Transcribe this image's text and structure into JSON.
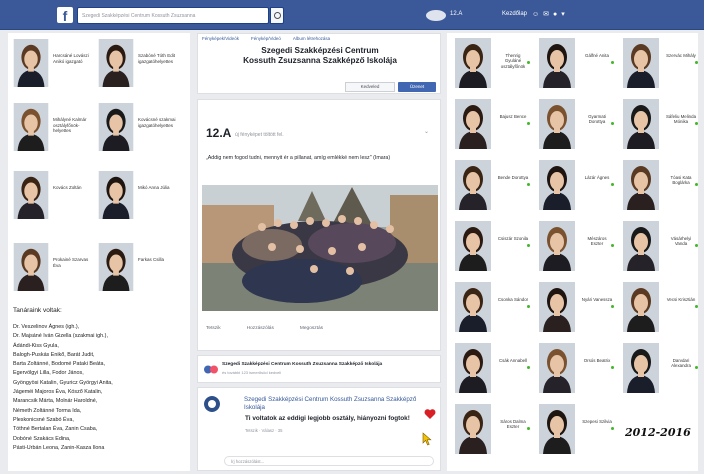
{
  "topbar": {
    "search_placeholder": "Szegedi Szakképzési Centrum Kossuth Zsuzsanna",
    "user": "12.A",
    "home": "Kezdőlap",
    "icons": [
      "people-icon",
      "messages-icon",
      "notifications-icon",
      "settings-icon"
    ]
  },
  "page": {
    "tabs": [
      "Fényképek/Videók",
      "Fénykép/Videó",
      "Album létrehozása"
    ],
    "title_line1": "Szegedi Szakképzési Centrum",
    "title_line2": "Kossuth Zsuzsanna Szakképző Iskolája",
    "liked_label": "Kedveled",
    "message_label": "Üzenet"
  },
  "post": {
    "class_name": "12.A",
    "subtitle": "új fényképet töltött fel.",
    "quote": "„Addig nem fogod tudni, mennyit ér a pillanat, amíg emlékké nem lesz\"",
    "quote_author": "(Imara)",
    "actions": [
      "Tetszik",
      "Hozzászólás",
      "Megosztás"
    ]
  },
  "share": {
    "title": "Szegedi Szakképzési Centrum Kossuth Zsuzsanna Szakképző Iskolája",
    "subtitle": "és további 123 ismerősöd kedveli"
  },
  "comment": {
    "author": "Szegedi Szakképzési Centrum Kossuth Zsuzsanna Szakképző Iskolája",
    "text": "Ti voltatok az eddigi legjobb osztály, hiányozni fogtok!",
    "meta": "Tetszik · Válasz · 35",
    "write_placeholder": "Írj hozzászólást..."
  },
  "staff": [
    {
      "name": "Harcsáné Lovászi Anikó igazgató"
    },
    {
      "name": "Szabóné Tóth Edit igazgatóhelyettes"
    },
    {
      "name": "Mihályné Kalmár osztályfőnök-helyettes"
    },
    {
      "name": "Kovácsné szakmai igazgatóhelyettes"
    },
    {
      "name": "Kovács Zoltán"
    },
    {
      "name": "Mikó Anna Júlia"
    },
    {
      "name": "Prokainé Szarvas Éva"
    },
    {
      "name": "Farkas Csilla"
    }
  ],
  "teachers_title": "Tanáraink voltak:",
  "teachers": [
    "Dr. Veszelinov Ágnes (igh.),",
    "Dr. Majsáné Iván Gizella (szakmai igh.),",
    "Ádándi-Kiss Gyula,",
    "Balogh-Puskás Enikő, Barát Judit,",
    "Barta Zoltánné, Bodomé Pataki Beáta,",
    "Egervölgyi Lilla, Fodor János,",
    "Gyöngyösi Katalin, Gyuricz Györgyi Anita,",
    "Jágeméi Majoros Éva, Kósző Katalin,",
    "Marancsik Márta, Molnár Haroldné,",
    "Németh Zoltánné Torma Ida,",
    "Pleskonicsné Szabó Éva,",
    "Tóthné Bertalan Éva, Zanin Csaba,",
    "Dobóné Szakács Edina,",
    "Pásti-Urbán Leona, Zanin-Kasza Ilona"
  ],
  "students": [
    {
      "name": "Thenrig Gyuláné osztályfőnök"
    },
    {
      "name": "Gálfné Anita"
    },
    {
      "name": "Szervác Mihály"
    },
    {
      "name": "Bajusz Bence"
    },
    {
      "name": "Gyarmati Dorottya"
    },
    {
      "name": "Sáfeliu Melinda Mónika"
    },
    {
      "name": "Bende Dorottya"
    },
    {
      "name": "Lázár Ágnes"
    },
    {
      "name": "Tóasi Kata Boglárka"
    },
    {
      "name": "Csiszár Szonila"
    },
    {
      "name": "Mészáros Eszter"
    },
    {
      "name": "Vásárhelyi Vanda"
    },
    {
      "name": "Csonka Sándor"
    },
    {
      "name": "Nyári Vanessza"
    },
    {
      "name": "Vecsi Krisztián"
    },
    {
      "name": "Csák Annabell"
    },
    {
      "name": "Orsós Beatrix"
    },
    {
      "name": "Darvdari Alexandra"
    },
    {
      "name": "Sáros Dalma Eszter"
    },
    {
      "name": "Szepesi Szilvia"
    }
  ],
  "year_range": "2012-2016"
}
